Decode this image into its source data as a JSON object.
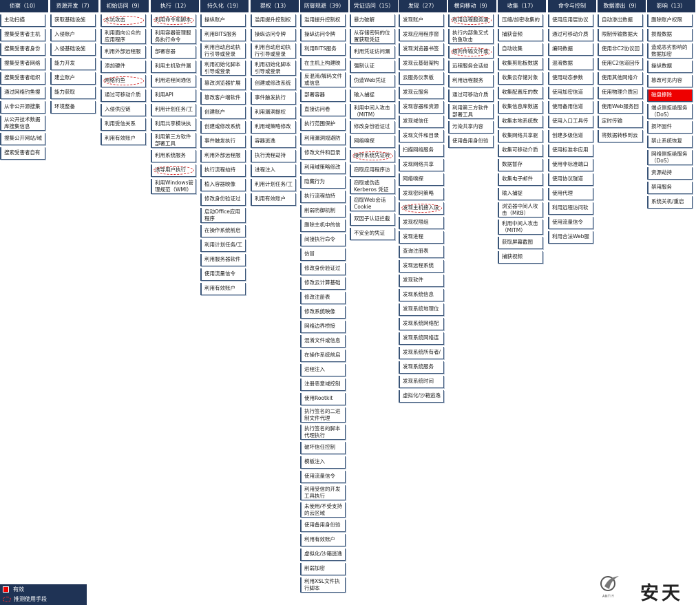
{
  "legend": {
    "effective_label": "有效",
    "guess_label": "推测使用手段",
    "effective_color": "#ee0000",
    "guess_color": "#d42020"
  },
  "logo": {
    "wordmark": "安天",
    "latin": "ANTIY",
    "symbol": "©"
  },
  "columns": [
    {
      "header": "侦察（10）",
      "items": [
        {
          "label": "主动扫描"
        },
        {
          "label": "搜集受害者主机信息"
        },
        {
          "label": "搜集受害者身份信息"
        },
        {
          "label": "搜集受害者网络信息"
        },
        {
          "label": "搜集受害者组织信息"
        },
        {
          "label": "通过网络钓鱼搜集信息"
        },
        {
          "label": "从非公开源搜集信息"
        },
        {
          "label": "从公开技术数据库搜集信息"
        },
        {
          "label": "搜集公开网站/域"
        },
        {
          "label": "搜索受害者自有网站"
        }
      ]
    },
    {
      "header": "资源开发（7）",
      "items": [
        {
          "label": "获取基础设施"
        },
        {
          "label": "入侵账户"
        },
        {
          "label": "入侵基础设施"
        },
        {
          "label": "能力开发"
        },
        {
          "label": "建立账户"
        },
        {
          "label": "能力获取"
        },
        {
          "label": "环境整备"
        }
      ]
    },
    {
      "header": "初始访问（9）",
      "items": [
        {
          "label": "水坑攻击",
          "guess": true
        },
        {
          "label": "利用面向公众的应用程序"
        },
        {
          "label": "利用外部远程服务"
        },
        {
          "label": "添加硬件"
        },
        {
          "label": "网络钓鱼",
          "guess": true
        },
        {
          "label": "通过可移动介质复制"
        },
        {
          "label": "入侵供应链"
        },
        {
          "label": "利用受信关系"
        },
        {
          "label": "利用有效账户"
        }
      ]
    },
    {
      "header": "执行（12）",
      "items": [
        {
          "label": "利用命令和脚本解释器",
          "guess": true
        },
        {
          "label": "利用容器管理服务执行命令"
        },
        {
          "label": "部署容器"
        },
        {
          "label": "利用主机软件漏洞执行"
        },
        {
          "label": "利用进程间通信"
        },
        {
          "label": "利用API"
        },
        {
          "label": "利用计划任务/工作"
        },
        {
          "label": "利用共享模块执行"
        },
        {
          "label": "利用第三方软件部署工具"
        },
        {
          "label": "利用系统服务"
        },
        {
          "label": "诱导用户执行",
          "guess": true
        },
        {
          "label": "利用Windows管理规范（WMI）"
        }
      ]
    },
    {
      "header": "持久化（19）",
      "items": [
        {
          "label": "操纵账户"
        },
        {
          "label": "利用BITS服务"
        },
        {
          "label": "利用自动启动执行引导或登录"
        },
        {
          "label": "利用初始化脚本引导或登录"
        },
        {
          "label": "篡改浏览器扩展插件"
        },
        {
          "label": "篡改客户端软件"
        },
        {
          "label": "创建账户"
        },
        {
          "label": "创建或修改系统进程"
        },
        {
          "label": "事件触发执行"
        },
        {
          "label": "利用外部远程服务"
        },
        {
          "label": "执行流程劫持"
        },
        {
          "label": "植入容器映像"
        },
        {
          "label": "修改身份验证过程"
        },
        {
          "label": "启动Office应用程序"
        },
        {
          "label": "在操作系统前启动"
        },
        {
          "label": "利用计划任务/工作"
        },
        {
          "label": "利用服务器软件组件"
        },
        {
          "label": "使用流量信令"
        },
        {
          "label": "利用有效账户"
        }
      ]
    },
    {
      "header": "提权（13）",
      "items": [
        {
          "label": "滥用提升控制权限机制"
        },
        {
          "label": "操纵访问令牌"
        },
        {
          "label": "利用自动启动执行引导或登录"
        },
        {
          "label": "利用初始化脚本引导或登录"
        },
        {
          "label": "创建或修改系统进程"
        },
        {
          "label": "事件触发执行"
        },
        {
          "label": "利用漏洞提权"
        },
        {
          "label": "利用域策略修改"
        },
        {
          "label": "容器逃逸"
        },
        {
          "label": "执行流程劫持"
        },
        {
          "label": "进程注入"
        },
        {
          "label": "利用计划任务/工作"
        },
        {
          "label": "利用有效账户"
        }
      ]
    },
    {
      "header": "防御规避（39）",
      "items": [
        {
          "label": "滥用提升控制权限机制"
        },
        {
          "label": "操纵访问令牌"
        },
        {
          "label": "利用BITS服务"
        },
        {
          "label": "在主机上构建映像"
        },
        {
          "label": "反混淆/解码文件或信息"
        },
        {
          "label": "部署容器"
        },
        {
          "label": "直接访问卷"
        },
        {
          "label": "执行范围保护"
        },
        {
          "label": "利用漏洞规避防御"
        },
        {
          "label": "修改文件和目录权限"
        },
        {
          "label": "利用域策略修改"
        },
        {
          "label": "隐藏行为"
        },
        {
          "label": "执行流程劫持"
        },
        {
          "label": "削弱防御机制"
        },
        {
          "label": "删除主机中的信标"
        },
        {
          "label": "间接执行命令"
        },
        {
          "label": "仿冒"
        },
        {
          "label": "修改身份验证过程"
        },
        {
          "label": "修改云计算基础架构"
        },
        {
          "label": "修改注册表"
        },
        {
          "label": "修改系统映像"
        },
        {
          "label": "网络边界桥接"
        },
        {
          "label": "混淆文件或信息"
        },
        {
          "label": "在操作系统前启动"
        },
        {
          "label": "进程注入"
        },
        {
          "label": "注册恶意域控制器"
        },
        {
          "label": "使用Rootkit"
        },
        {
          "label": "执行签名的二进制文件代理"
        },
        {
          "label": "执行签名的脚本代理执行"
        },
        {
          "label": "破坏信任控制"
        },
        {
          "label": "模板注入"
        },
        {
          "label": "使用流量信令"
        },
        {
          "label": "利用受信的开发工具执行"
        },
        {
          "label": "未使用/不受支持的云区域"
        },
        {
          "label": "使用备用身份验证材料"
        },
        {
          "label": "利用有效账户"
        },
        {
          "label": "虚拟化/沙箱逃逸"
        },
        {
          "label": "削弱加密"
        },
        {
          "label": "利用XSL文件执行脚本"
        }
      ]
    },
    {
      "header": "凭证访问（15）",
      "items": [
        {
          "label": "暴力破解"
        },
        {
          "label": "从存储密码的位置获取凭证"
        },
        {
          "label": "利用凭证访问漏洞"
        },
        {
          "label": "强制认证"
        },
        {
          "label": "伪造Web凭证"
        },
        {
          "label": "输入捕捉"
        },
        {
          "label": "利用中间人攻击（MITM）"
        },
        {
          "label": "修改身份验证过程"
        },
        {
          "label": "网络嗅探"
        },
        {
          "label": "操作系统凭证转储",
          "guess": true
        },
        {
          "label": "窃取应用程序访问令牌"
        },
        {
          "label": "窃取或伪造Kerberos 凭证"
        },
        {
          "label": "窃取Web会话Cookie"
        },
        {
          "label": "双因子认证拦截"
        },
        {
          "label": "不安全的凭证"
        }
      ]
    },
    {
      "header": "发现（27）",
      "items": [
        {
          "label": "发现账户"
        },
        {
          "label": "发现应用程序窗口"
        },
        {
          "label": "发现浏览器书签"
        },
        {
          "label": "发现云基础架构"
        },
        {
          "label": "云服务仪表板"
        },
        {
          "label": "发现云服务"
        },
        {
          "label": "发现容器和资源"
        },
        {
          "label": "发现域信任"
        },
        {
          "label": "发现文件和目录"
        },
        {
          "label": "扫描网络服务"
        },
        {
          "label": "发现网络共享"
        },
        {
          "label": "网络嗅探"
        },
        {
          "label": "发现密码策略"
        },
        {
          "label": "发现主机接入设备",
          "guess": true
        },
        {
          "label": "发现权限组"
        },
        {
          "label": "发现进程"
        },
        {
          "label": "查询注册表"
        },
        {
          "label": "发现远程系统"
        },
        {
          "label": "发现软件"
        },
        {
          "label": "发现系统信息"
        },
        {
          "label": "发现系统地理位置"
        },
        {
          "label": "发现系统网络配置"
        },
        {
          "label": "发现系统网络连接"
        },
        {
          "label": "发现系统所有者/用户"
        },
        {
          "label": "发现系统服务"
        },
        {
          "label": "发现系统时间"
        },
        {
          "label": "虚拟化/沙箱逃逸"
        }
      ]
    },
    {
      "header": "横向移动（9）",
      "items": [
        {
          "label": "利用远程服务漏洞",
          "guess": true
        },
        {
          "label": "执行内部鱼叉式钓鱼攻击"
        },
        {
          "label": "横向传输文件或工具",
          "guess": true
        },
        {
          "label": "远程服务会话劫持"
        },
        {
          "label": "利用远程服务"
        },
        {
          "label": "通过可移动介质复制"
        },
        {
          "label": "利用第三方软件部署工具"
        },
        {
          "label": "污染共享内容"
        },
        {
          "label": "使用备用身份验证材料"
        }
      ]
    },
    {
      "header": "收集（17）",
      "items": [
        {
          "label": "压缩/加密收集的数据"
        },
        {
          "label": "捕获音频"
        },
        {
          "label": "自动收集"
        },
        {
          "label": "收集剪贴板数据"
        },
        {
          "label": "收集云存储对象的数据"
        },
        {
          "label": "收集配置库的数据"
        },
        {
          "label": "收集信息库数据"
        },
        {
          "label": "收集本地系统数据"
        },
        {
          "label": "收集网络共享驱动数据"
        },
        {
          "label": "收集可移动介质数据"
        },
        {
          "label": "数据暂存"
        },
        {
          "label": "收集电子邮件"
        },
        {
          "label": "输入捕捉"
        },
        {
          "label": "浏览器中间人攻击（MitB）"
        },
        {
          "label": "利用中间人攻击（MITM）"
        },
        {
          "label": "获取屏幕截图"
        },
        {
          "label": "捕获视频"
        }
      ]
    },
    {
      "header": "命令与控制",
      "items": [
        {
          "label": "使用应用层协议"
        },
        {
          "label": "通过可移动介质通信"
        },
        {
          "label": "编码数据"
        },
        {
          "label": "混淆数据"
        },
        {
          "label": "使用动态参数"
        },
        {
          "label": "使用加密信道"
        },
        {
          "label": "使用备用信道"
        },
        {
          "label": "使用入口工具传输"
        },
        {
          "label": "创建多级信道"
        },
        {
          "label": "使用标准非应用层协议"
        },
        {
          "label": "使用非标准端口"
        },
        {
          "label": "使用协议隧道"
        },
        {
          "label": "使用代理"
        },
        {
          "label": "利用远程访问软件"
        },
        {
          "label": "使用流量信令"
        },
        {
          "label": "利用合法Web服务"
        }
      ]
    },
    {
      "header": "数据渗出（9）",
      "items": [
        {
          "label": "自动渗出数据"
        },
        {
          "label": "限制传输数据大小"
        },
        {
          "label": "使用非C2协议回传"
        },
        {
          "label": "使用C2信道回传"
        },
        {
          "label": "使用其他网络介质回传"
        },
        {
          "label": "使用物理介质回传"
        },
        {
          "label": "使用Web服务回传"
        },
        {
          "label": "定时传输"
        },
        {
          "label": "将数据转移到云账户"
        }
      ]
    },
    {
      "header": "影响（13）",
      "items": [
        {
          "label": "删除账户权限"
        },
        {
          "label": "损毁数据"
        },
        {
          "label": "造成恶劣影响的数据加密"
        },
        {
          "label": "操纵数据"
        },
        {
          "label": "篡改可见内容"
        },
        {
          "label": "磁盘擦除",
          "effective": true
        },
        {
          "label": "端点侧拒绝服务（DoS）"
        },
        {
          "label": "损坏固件"
        },
        {
          "label": "禁止系统恢复"
        },
        {
          "label": "网络侧拒绝服务（DoS）"
        },
        {
          "label": "资源劫持"
        },
        {
          "label": "禁用服务"
        },
        {
          "label": "系统关机/重启"
        }
      ]
    }
  ]
}
